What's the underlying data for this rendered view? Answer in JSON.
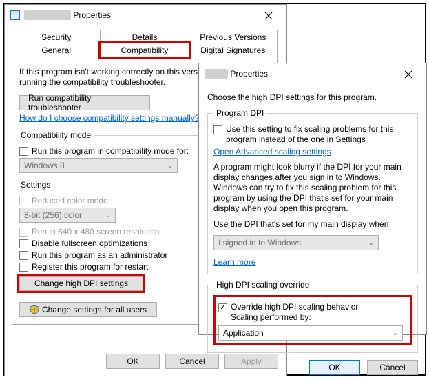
{
  "win1": {
    "title_blur": "████████",
    "title_suffix": "Properties",
    "tabs_top": [
      "Security",
      "Details",
      "Previous Versions"
    ],
    "tabs_bot": [
      "General",
      "Compatibility",
      "Digital Signatures"
    ],
    "intro": "If this program isn't working correctly on this version of Windows, try running the compatibility troubleshooter.",
    "run_trouble": "Run compatibility troubleshooter",
    "link_manual": "How do I choose compatibility settings manually?",
    "compat_mode_legend": "Compatibility mode",
    "compat_mode_cb": "Run this program in compatibility mode for:",
    "compat_mode_sel": "Windows 8",
    "settings_legend": "Settings",
    "reduced_color": "Reduced color mode",
    "color_sel": "8-bit (256) color",
    "run_640": "Run in 640 x 480 screen resolution",
    "disable_fs": "Disable fullscreen optimizations",
    "run_admin": "Run this program as an administrator",
    "register_restart": "Register this program for restart",
    "change_dpi": "Change high DPI settings",
    "change_all": "Change settings for all users",
    "ok": "OK",
    "cancel": "Cancel",
    "apply": "Apply"
  },
  "win2": {
    "title_blur": "████",
    "title_suffix": "Properties",
    "intro": "Choose the high DPI settings for this program.",
    "prog_dpi_legend": "Program DPI",
    "use_setting": "Use this setting to fix scaling problems for this program instead of the one in Settings",
    "open_adv": "Open Advanced scaling settings",
    "blurb": "A program might look blurry if the DPI for your main display changes after you sign in to Windows. Windows can try to fix this scaling problem for this program by using the DPI that's set for your main display when you open this program.",
    "use_dpi_when": "Use the DPI that's set for my main display when",
    "when_sel": "I signed in to Windows",
    "learn_more": "Learn more",
    "override_legend": "High DPI scaling override",
    "override_cb1": "Override high DPI scaling behavior.",
    "override_cb2": "Scaling performed by:",
    "override_sel": "Application",
    "ok": "OK",
    "cancel": "Cancel"
  }
}
